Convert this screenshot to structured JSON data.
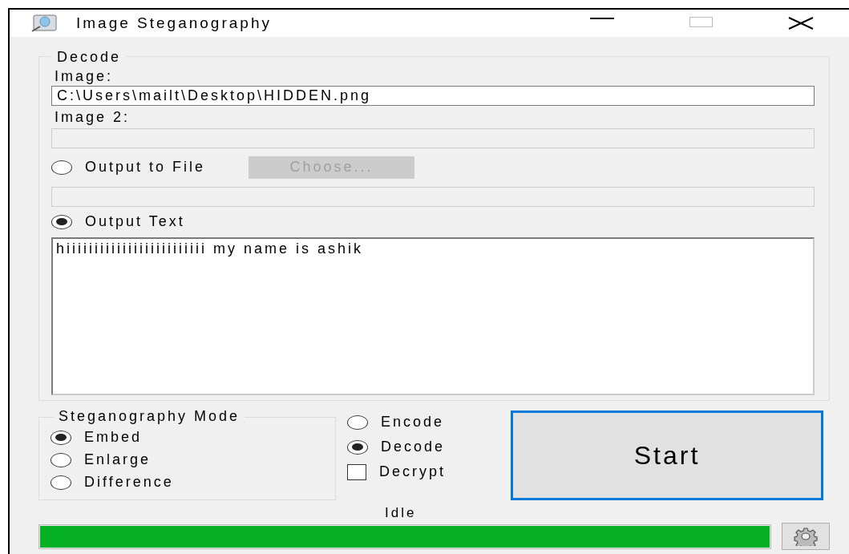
{
  "window": {
    "title": "Image Steganography"
  },
  "decode_group": {
    "title": "Decode",
    "image": {
      "label": "Image:",
      "value": "C:\\Users\\mailt\\Desktop\\HIDDEN.png",
      "disabled": false
    },
    "image_2": {
      "label": "Image 2:",
      "disabled": true
    },
    "output_options": [
      {
        "kind": "file",
        "label": "Output to File",
        "selected": false,
        "button": {
          "label": "Choose...",
          "disabled": true
        },
        "field": {
          "disabled": true
        }
      },
      {
        "kind": "text",
        "label": "Output Text",
        "selected": true,
        "text": "hiiiiiiiiiiiiiiiiiiiiiiiii my name is ashik"
      }
    ]
  },
  "mode_group": {
    "title": "Steganography Mode",
    "options": [
      {
        "label": "Embed",
        "selected": true
      },
      {
        "label": "Enlarge",
        "selected": false
      },
      {
        "label": "Difference",
        "selected": false
      }
    ]
  },
  "actions": [
    {
      "kind": "radio",
      "label": "Encode",
      "selected": false
    },
    {
      "kind": "radio",
      "label": "Decode",
      "selected": true
    },
    {
      "kind": "checkbox",
      "label": "Decrypt",
      "checked": false
    }
  ],
  "start_button": {
    "label": "Start",
    "focused": true
  },
  "status": {
    "text": "Idle",
    "level": 1
  }
}
